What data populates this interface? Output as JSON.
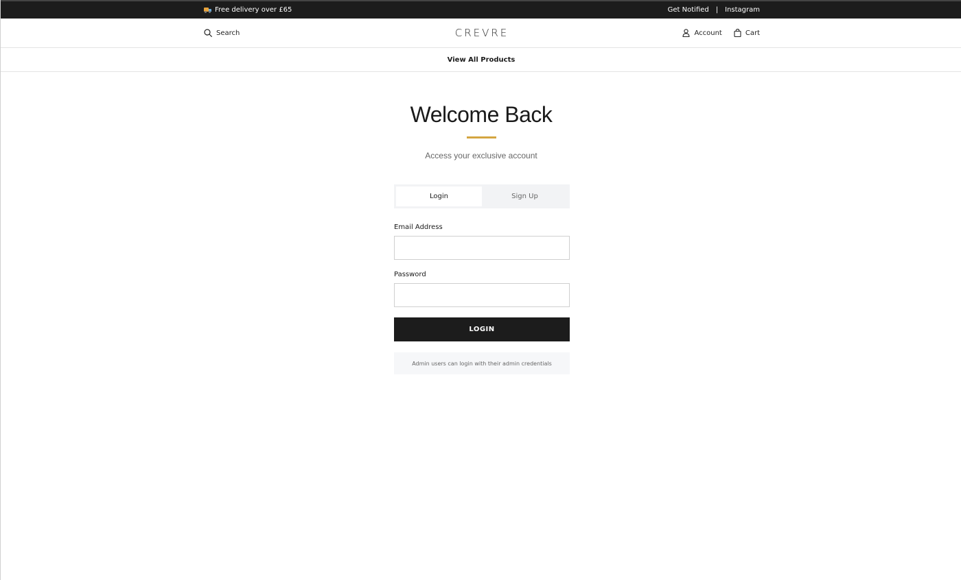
{
  "topbar": {
    "promo_icon": "truck-icon",
    "promo_text": "Free delivery over £65",
    "links": [
      "Get Notified",
      "|",
      "Instagram"
    ]
  },
  "header": {
    "search_label": "Search",
    "logo": "CREVRE",
    "account_label": "Account",
    "cart_label": "Cart"
  },
  "nav": {
    "view_all": "View All Products"
  },
  "auth": {
    "title": "Welcome Back",
    "subtitle": "Access your exclusive account",
    "tabs": [
      {
        "label": "Login",
        "active": true
      },
      {
        "label": "Sign Up",
        "active": false
      }
    ],
    "email_label": "Email Address",
    "email_value": "",
    "password_label": "Password",
    "password_value": "",
    "submit_label": "LOGIN",
    "note": "Admin users can login with their admin credentials"
  },
  "colors": {
    "accent": "#d4a540",
    "topbar_bg": "#1c1c1c",
    "button_bg": "#1c1c1c"
  }
}
